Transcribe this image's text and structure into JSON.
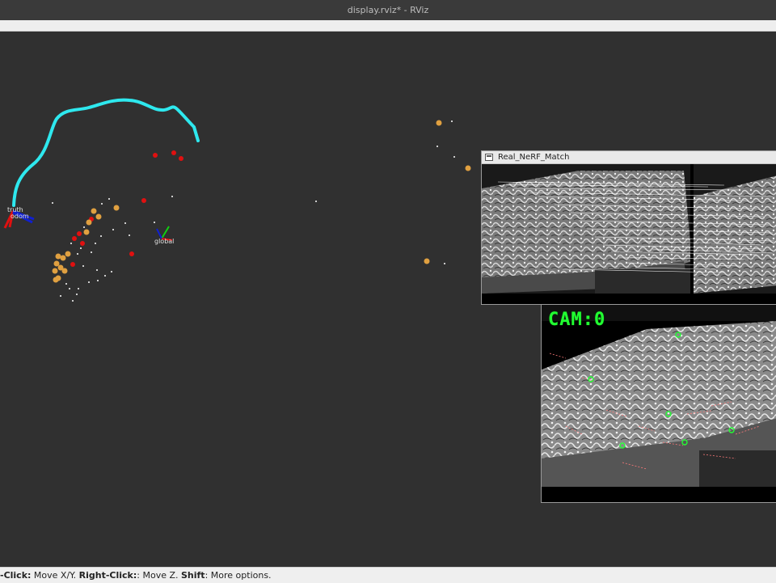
{
  "window": {
    "title": "display.rviz* - RViz"
  },
  "viewport": {
    "frames": [
      {
        "label": "truth"
      },
      {
        "label": "odom"
      },
      {
        "label": "global"
      }
    ],
    "colors": {
      "background": "#303030",
      "path": "#2ee8ee",
      "landmarks_orange": "#e0a040",
      "landmarks_red": "#e01010",
      "points_white": "#ffffff"
    }
  },
  "match_window": {
    "title": "Real_NeRF_Match",
    "icon": "window-icon"
  },
  "camera_window": {
    "overlay_label": "CAM:0"
  },
  "status": {
    "part1_bold": "-Click:",
    "part1_text": " Move X/Y. ",
    "part2_bold": "Right-Click:",
    "part2_text": ": Move Z. ",
    "part3_bold": "Shift",
    "part3_text": ": More options."
  }
}
